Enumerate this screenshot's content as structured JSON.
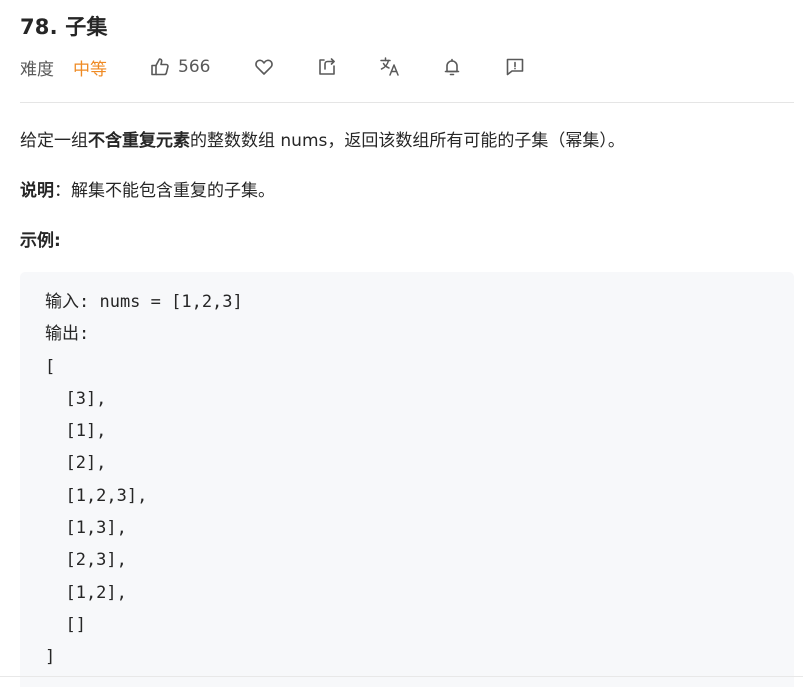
{
  "problem": {
    "title": "78. 子集",
    "difficulty_label": "难度",
    "difficulty_value": "中等",
    "likes": "566"
  },
  "icons": {
    "like": "thumbs-up-icon",
    "favorite": "heart-icon",
    "share": "share-icon",
    "translate": "translate-icon",
    "notify": "bell-icon",
    "feedback": "feedback-icon"
  },
  "colors": {
    "difficulty_medium": "#ef8a23",
    "code_background": "#f7f8fa"
  },
  "description": {
    "part1": "给定一组",
    "bold": "不含重复元素",
    "part2": "的整数数组 nums，返回该数组所有可能的子集（幂集）。"
  },
  "note": {
    "label": "说明",
    "text": "：解集不能包含重复的子集。"
  },
  "example": {
    "heading": "示例:",
    "lines": [
      "输入: nums = [1,2,3]",
      "输出:",
      "[",
      "  [3],",
      "  [1],",
      "  [2],",
      "  [1,2,3],",
      "  [1,3],",
      "  [2,3],",
      "  [1,2],",
      "  []",
      "]"
    ]
  }
}
